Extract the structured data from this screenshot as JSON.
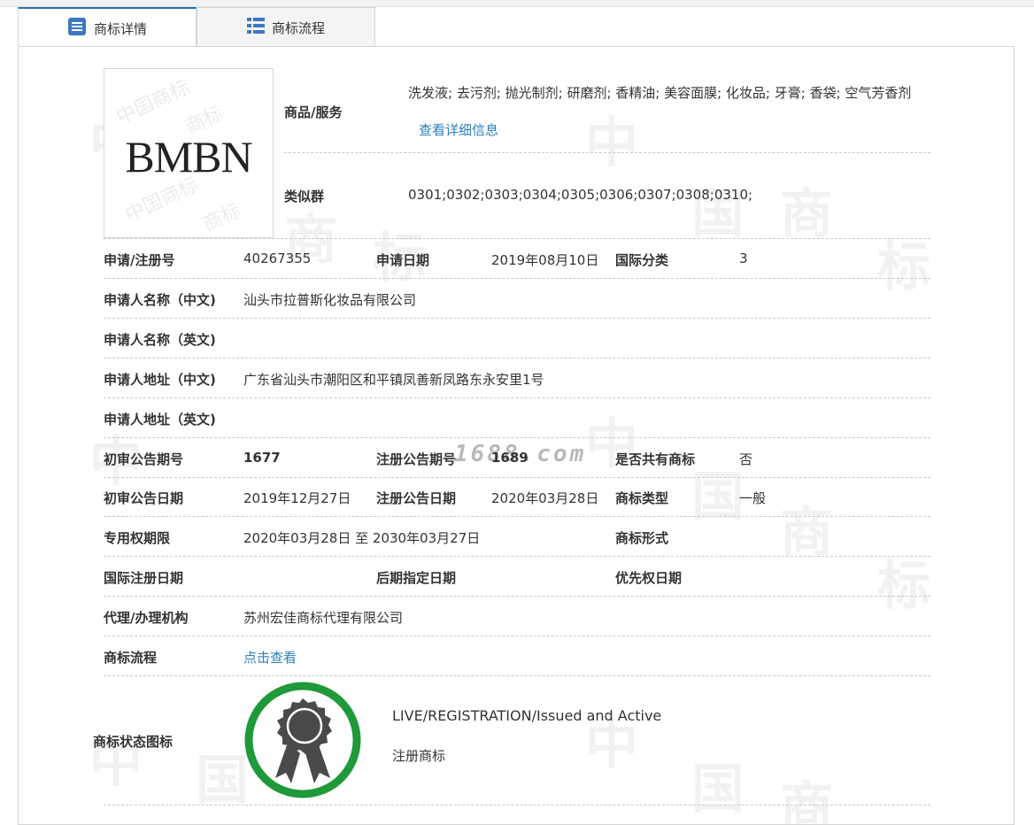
{
  "tabs": [
    {
      "label": "商标详情",
      "icon": "document-list-icon",
      "active": true
    },
    {
      "label": "商标流程",
      "icon": "list-icon",
      "active": false
    }
  ],
  "logo": {
    "text": "BMBN"
  },
  "goods": {
    "label": "商品/服务",
    "value": "洗发液; 去污剂; 抛光制剂; 研磨剂; 香精油; 美容面膜; 化妆品; 牙膏; 香袋; 空气芳香剂",
    "link": "查看详细信息"
  },
  "similar": {
    "label": "类似群",
    "value": "0301;0302;0303;0304;0305;0306;0307;0308;0310;"
  },
  "rows": {
    "reg_no_label": "申请/注册号",
    "reg_no": "40267355",
    "apply_date_label": "申请日期",
    "apply_date": "2019年08月10日",
    "intl_class_label": "国际分类",
    "intl_class": "3",
    "applicant_cn_label": "申请人名称（中文)",
    "applicant_cn": "汕头市拉普斯化妆品有限公司",
    "applicant_en_label": "申请人名称（英文)",
    "applicant_en": "",
    "address_cn_label": "申请人地址（中文)",
    "address_cn": "广东省汕头市潮阳区和平镇凤善新凤路东永安里1号",
    "address_en_label": "申请人地址（英文)",
    "address_en": "",
    "prelim_no_label": "初审公告期号",
    "prelim_no": "1677",
    "reg_notice_no_label": "注册公告期号",
    "reg_notice_no": "1689",
    "shared_label": "是否共有商标",
    "shared": "否",
    "prelim_date_label": "初审公告日期",
    "prelim_date": "2019年12月27日",
    "reg_notice_date_label": "注册公告日期",
    "reg_notice_date": "2020年03月28日",
    "tm_type_label": "商标类型",
    "tm_type": "一般",
    "term_label": "专用权期限",
    "term": "2020年03月28日 至 2030年03月27日",
    "tm_form_label": "商标形式",
    "tm_form": "",
    "intl_reg_date_label": "国际注册日期",
    "intl_reg_date": "",
    "later_date_label": "后期指定日期",
    "later_date": "",
    "priority_date_label": "优先权日期",
    "priority_date": "",
    "agent_label": "代理/办理机构",
    "agent": "苏州宏佳商标代理有限公司",
    "flow_label": "商标流程",
    "flow_link": "点击查看",
    "status_label": "商标状态图标",
    "status_en": "LIVE/REGISTRATION/Issued and Active",
    "status_cn": "注册商标"
  },
  "watermark": "1688.com",
  "colors": {
    "link": "#2c7fb8",
    "badge_ring": "#1f9a3a",
    "badge_medal": "#4a4a4a",
    "tab_active_border": "#2f6fb5"
  }
}
